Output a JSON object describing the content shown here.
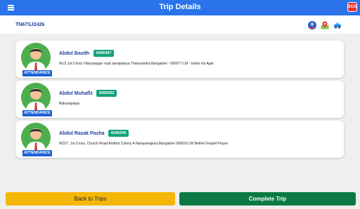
{
  "header": {
    "title": "Trip Details",
    "sos_label": "SOS"
  },
  "trip": {
    "vehicle_number": "TN67SJ2426"
  },
  "icons": {
    "menu": "menu-icon",
    "driver": "driver-avatar-icon",
    "map": "map-pin-icon",
    "vehicle": "car-icon"
  },
  "passengers": [
    {
      "name": "Abdul Basith",
      "emp_id": "6005307",
      "attendance_label": "ATTENDANCE",
      "address": "No:5 1st Cross Vidayasagar road saraipalaya Thanisandra Bangalore - 560077 LM - Indira Iris Apar"
    },
    {
      "name": "Abdul Muhaflz",
      "emp_id": "6005592",
      "attendance_label": "ATTENDANCE",
      "address": "Babusapalya"
    },
    {
      "name": "Abdul Razak Pasha",
      "emp_id": "6006205",
      "attendance_label": "ATTENDANCE",
      "address": "NO27, 1st Cross, Church Road Andhra Colony A Narayanapura Bangalore 560016 LM Bethel Gospel Prayer"
    }
  ],
  "buttons": {
    "back": "Back to Trips",
    "complete": "Complete Trip"
  },
  "colors": {
    "header": "#2a73ea",
    "back_button": "#f5b707",
    "complete_button": "#0a7a42",
    "badge": "#11a27c",
    "attendance": "#1e63d6",
    "sos": "#e8332e"
  }
}
